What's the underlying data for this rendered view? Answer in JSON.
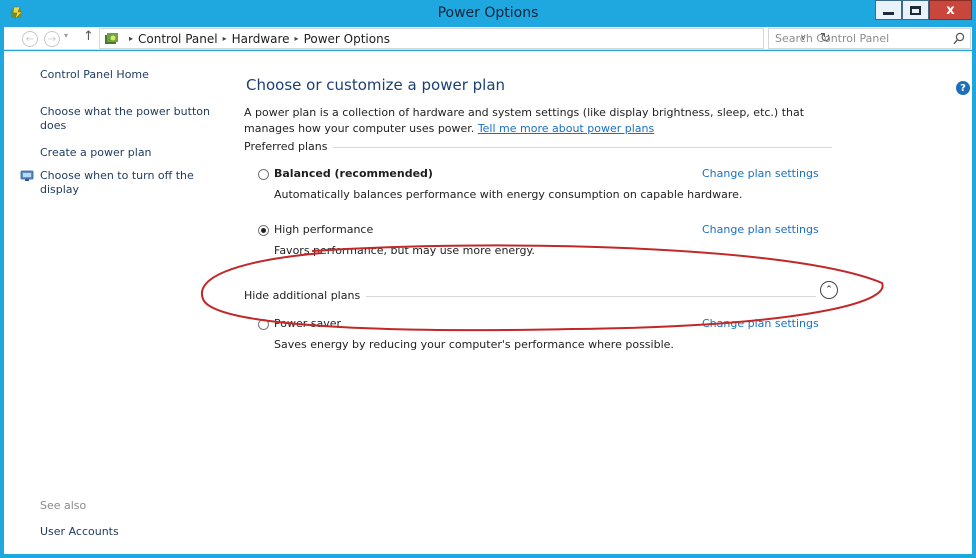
{
  "window": {
    "title": "Power Options",
    "minimize_icon": "minimize-icon",
    "maximize_icon": "maximize-icon",
    "close_glyph": "x"
  },
  "toolbar": {
    "back_glyph": "←",
    "forward_glyph": "→",
    "recent_glyph": "▾",
    "up_glyph": "↑",
    "breadcrumb": [
      "Control Panel",
      "Hardware",
      "Power Options"
    ],
    "separator": "▸",
    "dropdown_glyph": "∨",
    "refresh_glyph": "↻",
    "search_placeholder": "Search Control Panel"
  },
  "sidebar": {
    "items": [
      "Control Panel Home",
      "Choose what the power button does",
      "Create a power plan",
      "Choose when to turn off the display"
    ],
    "see_also_label": "See also",
    "see_also_items": [
      "User Accounts"
    ]
  },
  "main": {
    "title": "Choose or customize a power plan",
    "description": "A power plan is a collection of hardware and system settings (like display brightness, sleep, etc.) that manages how your computer uses power.",
    "description_link": "Tell me more about power plans",
    "preferred_label": "Preferred plans",
    "additional_label": "Hide additional plans",
    "expander_glyph": "⌃",
    "help_glyph": "?",
    "plans": [
      {
        "name": "Balanced (recommended)",
        "description": "Automatically balances performance with energy consumption on capable hardware.",
        "link": "Change plan settings",
        "selected": false
      },
      {
        "name": "High performance",
        "description": "Favors performance, but may use more energy.",
        "link": "Change plan settings",
        "selected": true
      },
      {
        "name": "Power saver",
        "description": "Saves energy by reducing your computer's performance where possible.",
        "link": "Change plan settings",
        "selected": false
      }
    ]
  },
  "colors": {
    "titlebar": "#1fa7e0",
    "link": "#1a6fc4",
    "heading": "#1b3f73",
    "annotation": "#c0282a",
    "close_button": "#c8463c"
  }
}
